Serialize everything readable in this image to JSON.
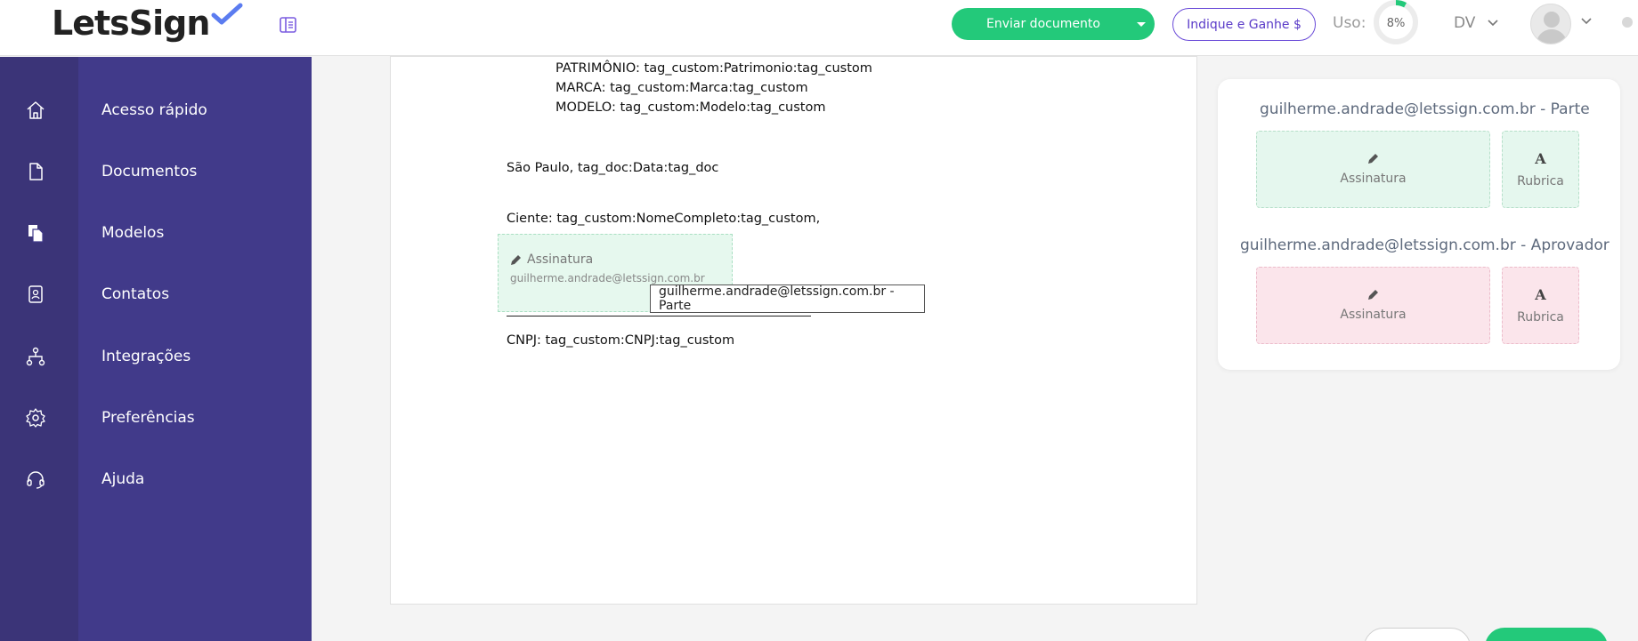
{
  "header": {
    "logo_text": "LetsSign",
    "send_button": "Enviar documento",
    "refer_button": "Indique e Ganhe $",
    "usage_label": "Uso:",
    "usage_value": "8%",
    "usage_fraction": 0.08,
    "user_initials": "DV"
  },
  "sidebar": {
    "items": [
      {
        "label": "Acesso rápido",
        "icon": "home-icon"
      },
      {
        "label": "Documentos",
        "icon": "document-icon"
      },
      {
        "label": "Modelos",
        "icon": "templates-icon"
      },
      {
        "label": "Contatos",
        "icon": "contacts-icon"
      },
      {
        "label": "Integrações",
        "icon": "integrations-icon"
      },
      {
        "label": "Preferências",
        "icon": "gear-icon"
      },
      {
        "label": "Ajuda",
        "icon": "headset-icon"
      }
    ]
  },
  "document": {
    "lines": [
      "PATRIMÔNIO: tag_custom:Patrimonio:tag_custom",
      "MARCA: tag_custom:Marca:tag_custom",
      "MODELO: tag_custom:Modelo:tag_custom",
      "São Paulo, tag_doc:Data:tag_doc",
      "Ciente: tag_custom:NomeCompleto:tag_custom,",
      "CNPJ: tag_custom:CNPJ:tag_custom"
    ],
    "signature_field": {
      "label": "Assinatura",
      "email": "guilherme.andrade@letssign.com.br"
    },
    "tooltip": "guilherme.andrade@letssign.com.br - Parte"
  },
  "signers": [
    {
      "title": "guilherme.andrade@letssign.com.br - Parte",
      "signature_label": "Assinatura",
      "initials_label": "Rubrica",
      "color": "#e5f7ee"
    },
    {
      "title": "guilherme.andrade@letssign.com.br - Aprovador",
      "signature_label": "Assinatura",
      "initials_label": "Rubrica",
      "color": "#fbe5eb"
    }
  ],
  "colors": {
    "accent_green": "#23c97a",
    "accent_purple": "#5a3bc8",
    "sidebar": "#413a8a",
    "sidebar_rail": "#3b3478"
  }
}
